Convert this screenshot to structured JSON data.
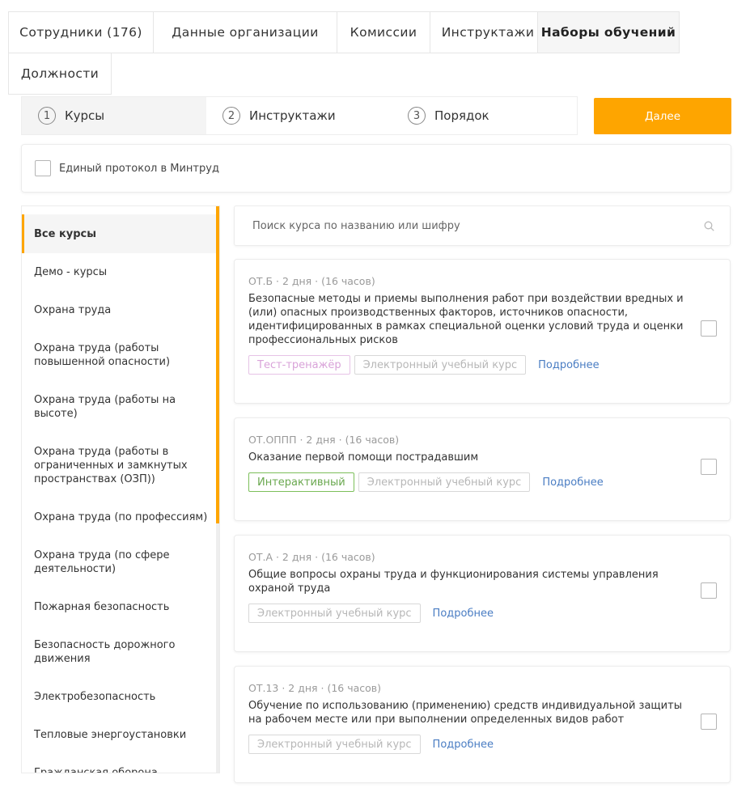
{
  "tabs": [
    {
      "label": "Сотрудники (176)"
    },
    {
      "label": "Данные организации"
    },
    {
      "label": "Комиссии"
    },
    {
      "label": "Инструктажи"
    },
    {
      "label": "Наборы обучений",
      "active": true
    },
    {
      "label": "Должности"
    }
  ],
  "stepper": {
    "steps": [
      {
        "num": "1",
        "label": "Курсы",
        "active": true
      },
      {
        "num": "2",
        "label": "Инструктажи"
      },
      {
        "num": "3",
        "label": "Порядок"
      }
    ],
    "next_label": "Далее"
  },
  "protocol": {
    "label": "Единый протокол в Минтруд",
    "checked": false
  },
  "categories": [
    "Все курсы",
    "Демо - курсы",
    "Охрана труда",
    "Охрана труда (работы повышенной опасности)",
    "Охрана труда (работы на высоте)",
    "Охрана труда (работы в ограниченных и замкнутых пространствах (ОЗП))",
    "Охрана труда (по профессиям)",
    "Охрана труда (по сфере деятельности)",
    "Пожарная безопасность",
    "Безопасность дорожного движения",
    "Электробезопасность",
    "Тепловые энергоустановки",
    "Гражданская оборона"
  ],
  "search": {
    "placeholder": "Поиск курса по названию или шифру",
    "value": ""
  },
  "courses": [
    {
      "meta": "ОТ.Б · 2 дня · (16 часов)",
      "title": "Безопасные методы и приемы выполнения работ при воздействии вредных и (или) опасных производственных факторов, источников опасности, идентифицированных в рамках специальной оценки условий труда и оценки профессиональных рисков",
      "tags": [
        "Тест-тренажёр",
        "Электронный учебный курс"
      ],
      "more": "Подробнее"
    },
    {
      "meta": "ОТ.ОППП · 2 дня · (16 часов)",
      "title": "Оказание первой помощи пострадавшим",
      "tags": [
        "Интерактивный",
        "Электронный учебный курс"
      ],
      "more": "Подробнее"
    },
    {
      "meta": "ОТ.А · 2 дня · (16 часов)",
      "title": "Общие вопросы охраны труда и функционирования системы управления охраной труда",
      "tags": [
        "Электронный учебный курс"
      ],
      "more": "Подробнее"
    },
    {
      "meta": "ОТ.13 · 2 дня · (16 часов)",
      "title": "Обучение по использованию (применению) средств индивидуальной защиты на рабочем месте или при выполнении определенных видов работ",
      "tags": [
        "Электронный учебный курс"
      ],
      "more": "Подробнее"
    }
  ],
  "colors": {
    "accent": "#fea500",
    "link": "#4a7dc3",
    "tag_green": "#6aa84f",
    "tag_pink": "#d9a3d9"
  }
}
